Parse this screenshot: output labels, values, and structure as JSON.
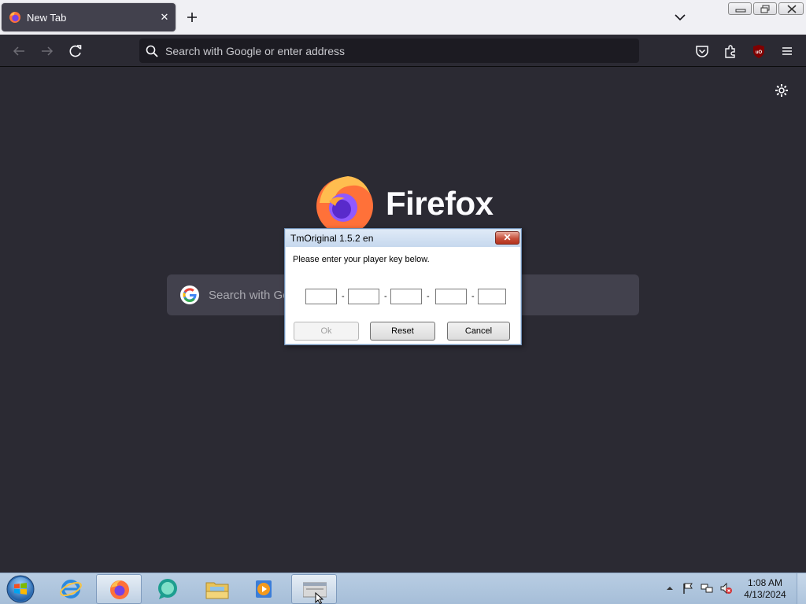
{
  "browser": {
    "tab": {
      "title": "New Tab"
    },
    "urlbar": {
      "placeholder": "Search with Google or enter address"
    },
    "newtab": {
      "wordmark": "Firefox",
      "search_placeholder": "Search with Google or enter address"
    },
    "extension_badge": "uO"
  },
  "dialog": {
    "title": "TmOriginal 1.5.2 en",
    "close_label": "✕",
    "message": "Please enter your player key below.",
    "key_fields": [
      "",
      "",
      "",
      "",
      ""
    ],
    "separator": "-",
    "ok_label": "Ok",
    "ok_enabled": false,
    "reset_label": "Reset",
    "cancel_label": "Cancel"
  },
  "taskbar": {
    "items": [
      {
        "name": "Internet Explorer",
        "icon": "ie-icon",
        "active": false
      },
      {
        "name": "Firefox",
        "icon": "firefox-icon",
        "active": true
      },
      {
        "name": "Chat app",
        "icon": "chat-bubble-icon",
        "active": false
      },
      {
        "name": "File Explorer",
        "icon": "folder-icon",
        "active": false
      },
      {
        "name": "Media Player",
        "icon": "media-player-icon",
        "active": false
      },
      {
        "name": "TmOriginal",
        "icon": "app-window-icon",
        "active": true
      }
    ],
    "clock": {
      "time": "1:08 AM",
      "date": "4/13/2024"
    }
  },
  "colors": {
    "browser_bg": "#2b2a33",
    "urlbar_bg": "#1c1b22",
    "taskbar": "#b8cde3",
    "dialog_bg": "#f0f0f0"
  }
}
